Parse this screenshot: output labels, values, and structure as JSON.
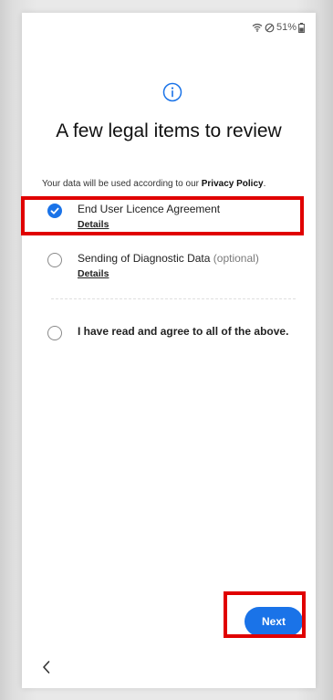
{
  "status_bar": {
    "battery": "51%",
    "icons": [
      "wifi-icon",
      "do-not-disturb-icon",
      "battery-icon"
    ]
  },
  "header": {
    "icon": "info-icon",
    "title": "A few legal items to review"
  },
  "intro": {
    "text": "Your data will be used according to our ",
    "link": "Privacy Policy",
    "suffix": "."
  },
  "options": [
    {
      "label": "End User Licence Agreement",
      "optional": "",
      "details": "Details",
      "checked": true
    },
    {
      "label": "Sending of Diagnostic Data",
      "optional": "(optional)",
      "details": "Details",
      "checked": false
    }
  ],
  "agree_all": {
    "label": "I have read and agree to all of the above.",
    "checked": false
  },
  "footer": {
    "next_label": "Next",
    "back_icon": "chevron-left-icon"
  },
  "colors": {
    "accent": "#1a73e8",
    "highlight": "#e00000"
  }
}
